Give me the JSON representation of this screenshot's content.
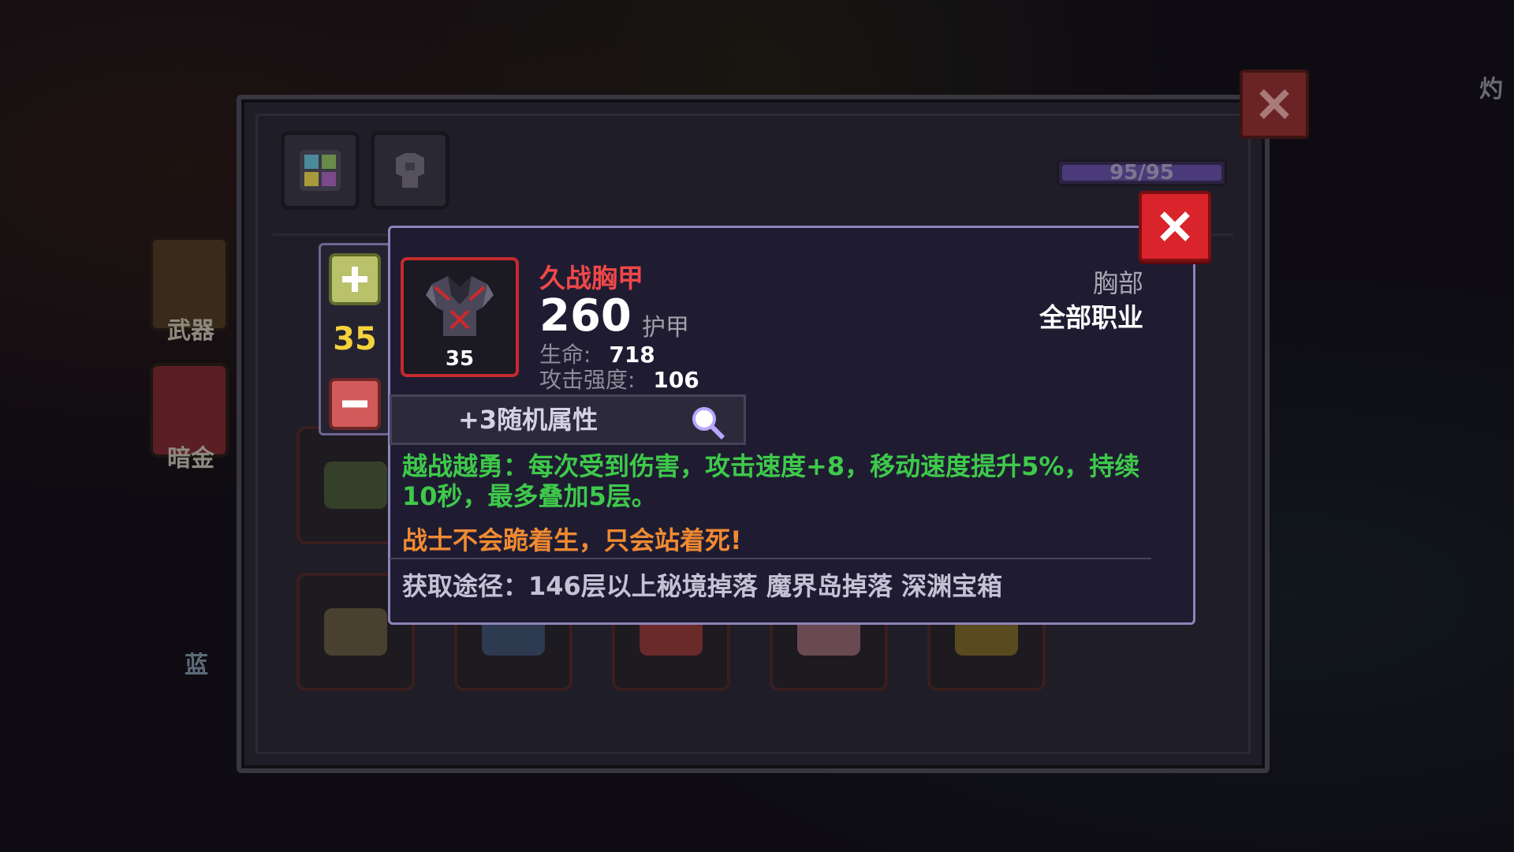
{
  "background": {
    "side_tabs": [
      {
        "label": "武器"
      },
      {
        "label": "暗金"
      }
    ],
    "corner_label": "灼",
    "bottom_label": "蓝"
  },
  "window": {
    "tabs": [
      {
        "icon": "grid-icon"
      },
      {
        "icon": "armor-silhouette-icon"
      }
    ],
    "capacity": {
      "text": "95/95",
      "fraction": 1.0
    },
    "close_icon": "close-icon"
  },
  "stepper": {
    "plus_icon": "plus-icon",
    "level": "35",
    "minus_icon": "minus-icon"
  },
  "tooltip": {
    "item_name": "久战胸甲",
    "item_level": "35",
    "armor_value": "260",
    "armor_label": "护甲",
    "stats": [
      {
        "label": "生命:",
        "value": "718"
      },
      {
        "label": "攻击强度:",
        "value": "106"
      }
    ],
    "slot": "胸部",
    "class": "全部职业",
    "random_attributes": "+3随机属性",
    "effect": "越战越勇：每次受到伤害，攻击速度+8，移动速度提升5%，持续10秒，最多叠加5层。",
    "quote": "战士不会跪着生，只会站着死!",
    "source": "获取途径：146层以上秘境掉落 魔界岛掉落 深渊宝箱",
    "colors": {
      "name": "#f04848",
      "effect": "#3ec94a",
      "quote": "#f08a32",
      "close": "#d8242a"
    }
  }
}
